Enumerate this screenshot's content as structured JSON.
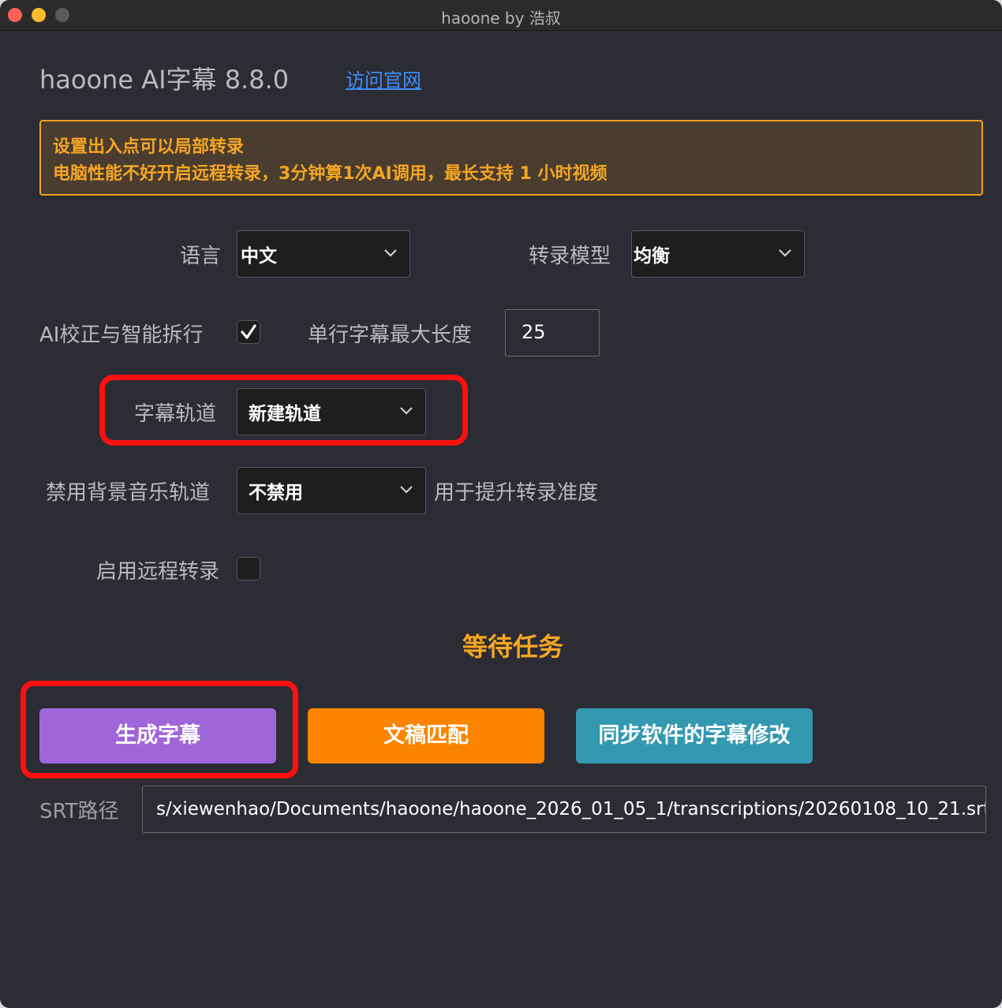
{
  "window": {
    "title": "haoone by 浩叔"
  },
  "header": {
    "app_title": "haoone AI字幕 8.8.0",
    "site_link": "访问官网"
  },
  "notice": {
    "line1": "设置出入点可以局部转录",
    "line2": "电脑性能不好开启远程转录，3分钟算1次AI调用，最长支持 1 小时视频"
  },
  "form": {
    "language_label": "语言",
    "language_value": "中文",
    "model_label": "转录模型",
    "model_value": "均衡",
    "ai_correct_label": "AI校正与智能拆行",
    "ai_correct_checked": true,
    "max_len_label": "单行字幕最大长度",
    "max_len_value": "25",
    "track_label": "字幕轨道",
    "track_value": "新建轨道",
    "bgm_label": "禁用背景音乐轨道",
    "bgm_value": "不禁用",
    "bgm_hint": "用于提升转录准度",
    "remote_label": "启用远程转录",
    "remote_checked": false
  },
  "status": {
    "text": "等待任务"
  },
  "buttons": {
    "generate": "生成字幕",
    "match": "文稿匹配",
    "sync": "同步软件的字幕修改"
  },
  "srt": {
    "label": "SRT路径",
    "value": "s/xiewenhao/Documents/haoone/haoone_2026_01_05_1/transcriptions/20260108_10_21.srt"
  },
  "colors": {
    "background": "#2c2c34",
    "accent_orange": "#f5a623",
    "button_purple": "#a066d9",
    "button_orange": "#fb8500",
    "button_teal": "#3299b0",
    "highlight_red": "#ff1010",
    "link_blue": "#3d8ef5"
  }
}
